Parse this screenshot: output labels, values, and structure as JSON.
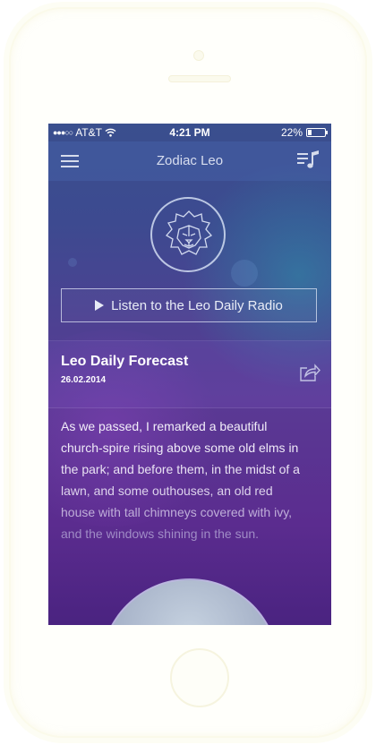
{
  "status_bar": {
    "carrier": "AT&T",
    "time": "4:21 PM",
    "battery": "22%",
    "battery_level": 0.22
  },
  "nav": {
    "title": "Zodiac Leo",
    "menu_icon": "hamburger-menu-icon",
    "playlist_icon": "playlist-music-icon"
  },
  "hero": {
    "emblem_icon": "leo-lion-icon",
    "radio_label": "Listen to the Leo Daily Radio"
  },
  "forecast": {
    "title": "Leo Daily Forecast",
    "date": "26.02.2014",
    "share_icon": "share-icon",
    "lines": [
      "As we passed, I remarked a beautiful",
      "church-spire rising above some old elms in",
      "the park; and before them, in the midst of a",
      "lawn, and some outhouses, an old red",
      "house with tall chimneys covered with ivy,",
      "and the windows shining in the sun."
    ]
  },
  "colors": {
    "bg_top": "#3a4f8e",
    "bg_bottom": "#5b2c8f",
    "text_primary": "#ffffff"
  }
}
